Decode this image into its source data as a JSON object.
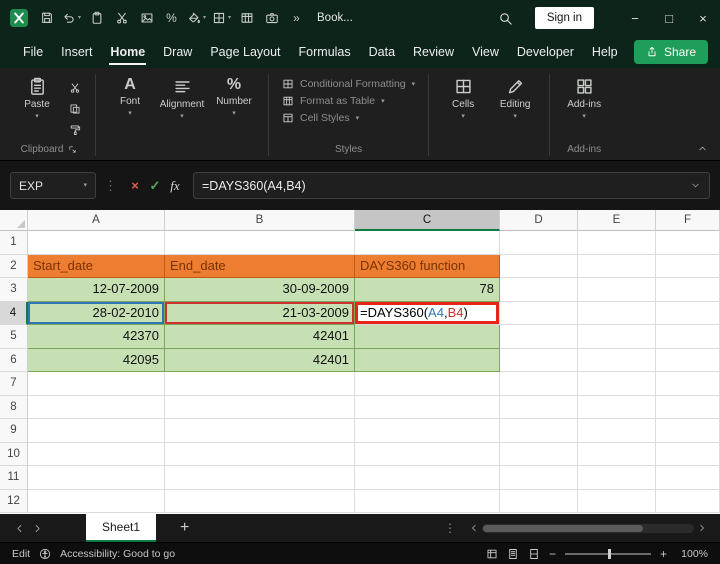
{
  "titlebar": {
    "workbook_title": "Book...",
    "sign_in": "Sign in",
    "quick_access": [
      {
        "icon": "save",
        "caret": false
      },
      {
        "icon": "undo",
        "caret": true
      },
      {
        "icon": "paste",
        "caret": false
      },
      {
        "icon": "cut",
        "caret": false
      },
      {
        "icon": "picture",
        "caret": false
      },
      {
        "icon": "percent",
        "caret": false
      },
      {
        "icon": "paint-bucket",
        "caret": true
      },
      {
        "icon": "borders",
        "caret": true
      },
      {
        "icon": "table",
        "caret": false
      },
      {
        "icon": "camera",
        "caret": false
      },
      {
        "icon": "more-commands",
        "caret": false
      }
    ]
  },
  "menu": {
    "items": [
      "File",
      "Insert",
      "Home",
      "Draw",
      "Page Layout",
      "Formulas",
      "Data",
      "Review",
      "View",
      "Developer",
      "Help"
    ],
    "active": "Home",
    "share": "Share"
  },
  "ribbon": {
    "paste": {
      "label": "Paste",
      "icon": "paste-big"
    },
    "clipboard_small": [
      {
        "icon": "cut"
      },
      {
        "icon": "copy"
      },
      {
        "icon": "format-painter"
      }
    ],
    "group1": [
      {
        "label": "Font",
        "icon": "font"
      },
      {
        "label": "Alignment",
        "icon": "alignment"
      },
      {
        "label": "Number",
        "icon": "number"
      }
    ],
    "styles": [
      {
        "label": "Conditional Formatting",
        "icon": "conditional-formatting"
      },
      {
        "label": "Format as Table",
        "icon": "format-as-table"
      },
      {
        "label": "Cell Styles",
        "icon": "cell-styles"
      }
    ],
    "group2": [
      {
        "label": "Cells",
        "icon": "cells"
      },
      {
        "label": "Editing",
        "icon": "editing"
      }
    ],
    "group3": [
      {
        "label": "Add-ins",
        "icon": "add-ins"
      }
    ],
    "labels": {
      "clipboard": "Clipboard",
      "styles": "Styles",
      "addins": "Add-ins"
    }
  },
  "formula_bar": {
    "name_box": "EXP",
    "formula": "=DAYS360(A4,B4)",
    "buttons": {
      "cancel": "×",
      "enter": "✓",
      "insert_function": "fx"
    }
  },
  "grid": {
    "col_headers": [
      "A",
      "B",
      "C",
      "D",
      "E",
      "F"
    ],
    "row_numbers": [
      "1",
      "2",
      "3",
      "4",
      "5",
      "6",
      "7",
      "8",
      "9",
      "10",
      "11",
      "12"
    ],
    "active_col": "C",
    "active_row": "4",
    "colors": {
      "orange_fill": "#ED7D31",
      "orange_border": "#BF5B16",
      "orange_text": "#7A3200",
      "green_fill": "#C6E0B4",
      "green_border": "#7DA65C",
      "ref_blue": "#2E75B6",
      "ref_red": "#CC3232",
      "annotation_red": "#E8231A"
    },
    "cells": {
      "A2": {
        "text": "Start_date",
        "style": "orange",
        "align": "left"
      },
      "B2": {
        "text": "End_date",
        "style": "orange",
        "align": "left"
      },
      "C2": {
        "text": "DAYS360 function",
        "style": "orange",
        "align": "left"
      },
      "A3": {
        "text": "12-07-2009",
        "style": "green",
        "align": "right"
      },
      "B3": {
        "text": "30-09-2009",
        "style": "green",
        "align": "right"
      },
      "C3": {
        "text": "78",
        "style": "green",
        "align": "right"
      },
      "A4": {
        "text": "28-02-2010",
        "style": "green",
        "align": "right",
        "ref": "blue"
      },
      "B4": {
        "text": "21-03-2009",
        "style": "green",
        "align": "right",
        "ref": "red"
      },
      "C4": {
        "style": "annotated",
        "align": "left",
        "parts": [
          {
            "text": "=DAYS360(",
            "color": "#000000"
          },
          {
            "text": "A4",
            "color": "#2E75B6"
          },
          {
            "text": ",",
            "color": "#000000"
          },
          {
            "text": "B4",
            "color": "#CC3232"
          },
          {
            "text": ")",
            "color": "#000000"
          }
        ]
      },
      "A5": {
        "text": "42370",
        "style": "green",
        "align": "right"
      },
      "B5": {
        "text": "42401",
        "style": "green",
        "align": "right"
      },
      "C5": {
        "text": "",
        "style": "green"
      },
      "A6": {
        "text": "42095",
        "style": "green",
        "align": "right"
      },
      "B6": {
        "text": "42401",
        "style": "green",
        "align": "right"
      },
      "C6": {
        "text": "",
        "style": "green"
      }
    }
  },
  "sheet_tabs": {
    "active": "Sheet1"
  },
  "status_bar": {
    "mode": "Edit",
    "accessibility": "Accessibility: Good to go",
    "zoom": "100%"
  }
}
